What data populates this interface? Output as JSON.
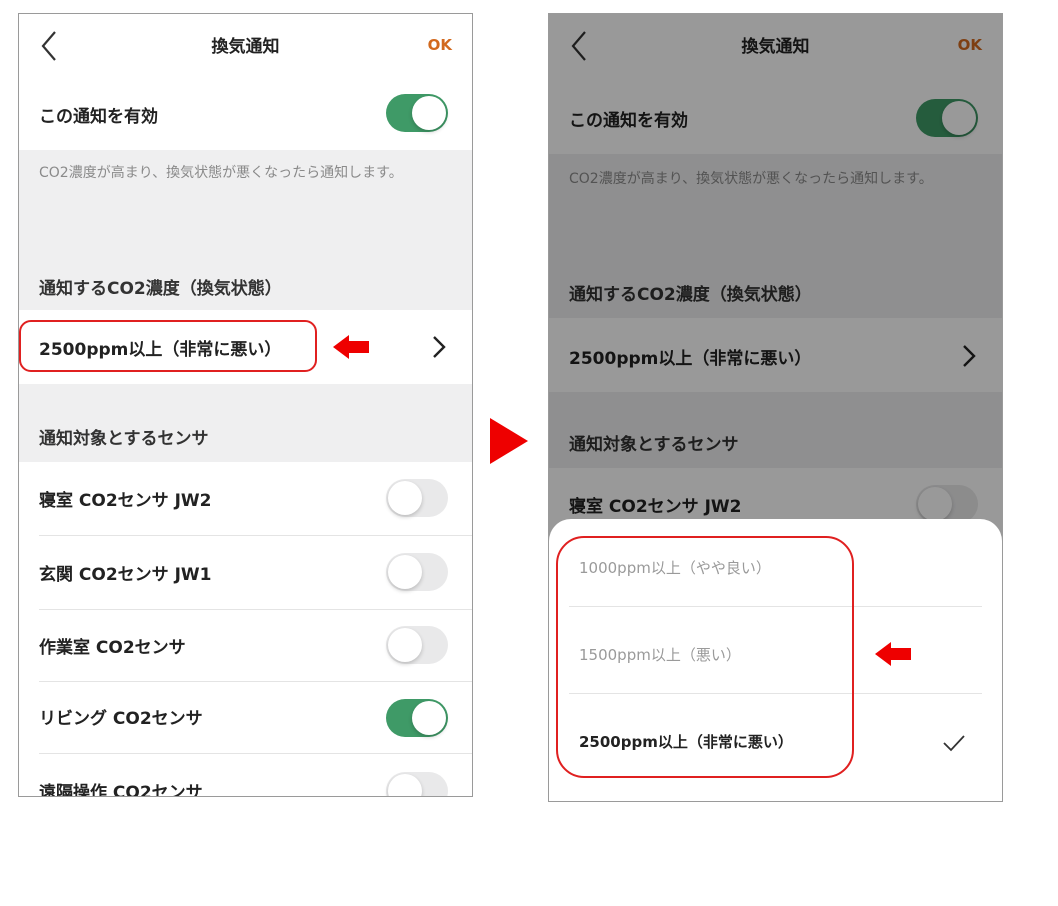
{
  "screen": {
    "title": "換気通知",
    "ok_label": "OK",
    "enable_label": "この通知を有効",
    "enable_on": true,
    "description": "CO2濃度が高まり、換気状態が悪くなったら通知します。",
    "threshold_section": "通知するCO2濃度（換気状態）",
    "threshold_value": "2500ppm以上（非常に悪い）",
    "sensors_section": "通知対象とするセンサ",
    "sensors": [
      {
        "name": "寝室 CO2センサ JW2",
        "on": false
      },
      {
        "name": "玄関 CO2センサ JW1",
        "on": false
      },
      {
        "name": "作業室 CO2センサ",
        "on": false
      },
      {
        "name": "リビング CO2センサ",
        "on": true
      },
      {
        "name": "遠隔操作 CO2センサ",
        "on": false
      }
    ]
  },
  "sheet": {
    "options": [
      {
        "label": "1000ppm以上（やや良い）",
        "enabled": false,
        "selected": false
      },
      {
        "label": "1500ppm以上（悪い）",
        "enabled": false,
        "selected": false
      },
      {
        "label": "2500ppm以上（非常に悪い）",
        "enabled": true,
        "selected": true
      }
    ]
  },
  "colors": {
    "accent_green": "#3f9a67",
    "ok_orange": "#d2691e",
    "highlight_red": "#e02020"
  }
}
